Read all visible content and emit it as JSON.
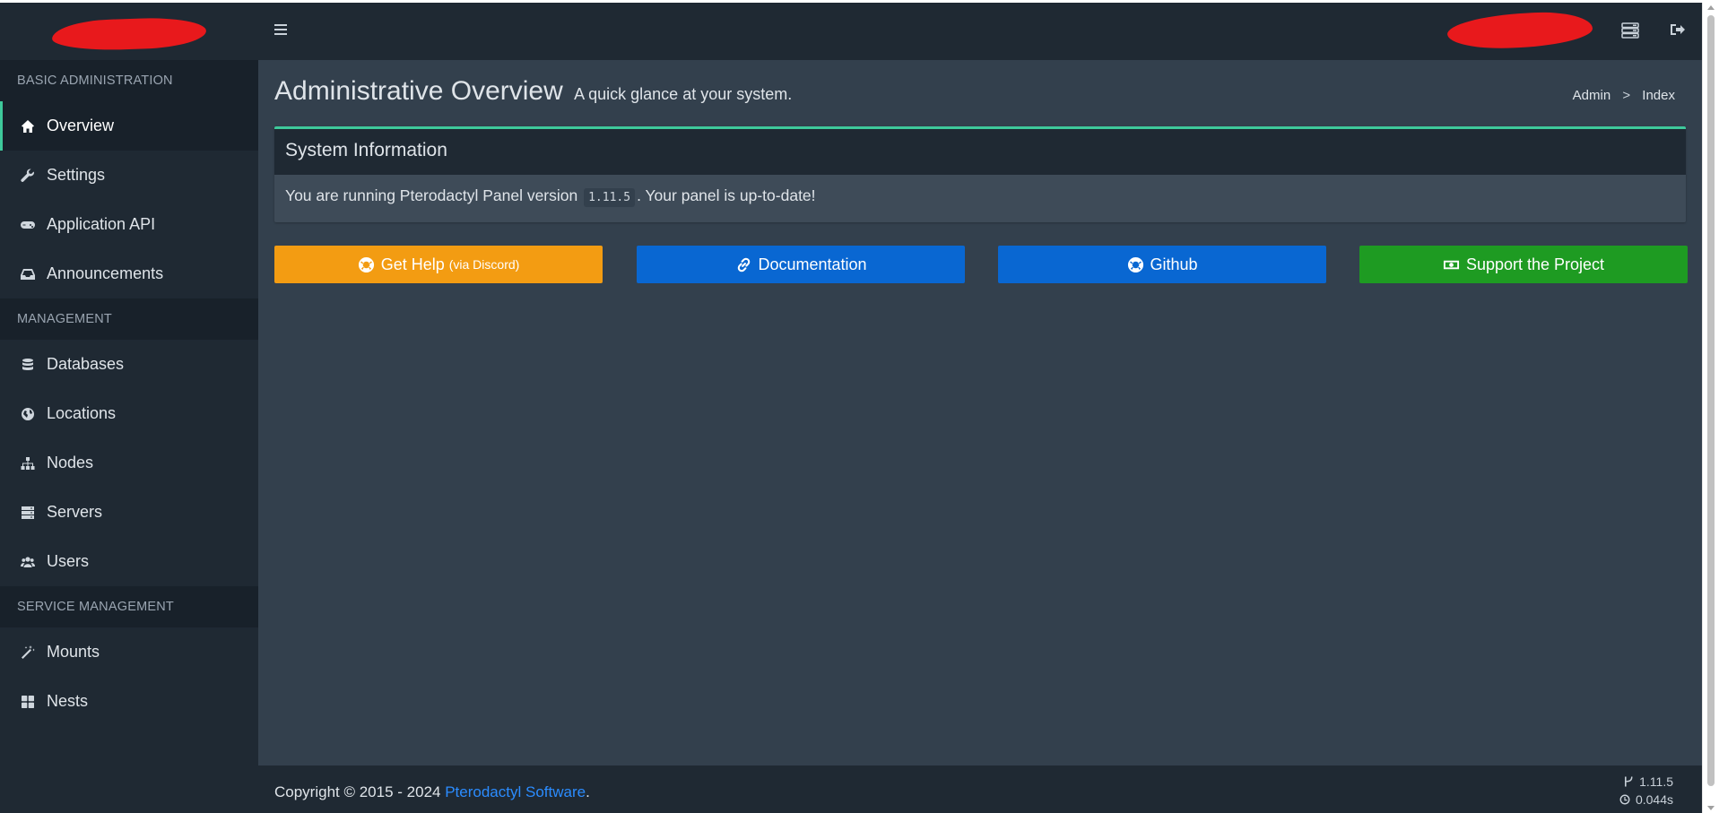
{
  "sidebar": {
    "sections": [
      {
        "header": "BASIC ADMINISTRATION",
        "items": [
          {
            "label": "Overview",
            "icon": "home-icon",
            "active": true
          },
          {
            "label": "Settings",
            "icon": "wrench-icon"
          },
          {
            "label": "Application API",
            "icon": "gamepad-icon"
          },
          {
            "label": "Announcements",
            "icon": "inbox-icon"
          }
        ]
      },
      {
        "header": "MANAGEMENT",
        "items": [
          {
            "label": "Databases",
            "icon": "database-icon"
          },
          {
            "label": "Locations",
            "icon": "globe-icon"
          },
          {
            "label": "Nodes",
            "icon": "sitemap-icon"
          },
          {
            "label": "Servers",
            "icon": "server-icon"
          },
          {
            "label": "Users",
            "icon": "users-icon"
          }
        ]
      },
      {
        "header": "SERVICE MANAGEMENT",
        "items": [
          {
            "label": "Mounts",
            "icon": "magic-wand-icon"
          },
          {
            "label": "Nests",
            "icon": "th-large-icon"
          }
        ]
      }
    ]
  },
  "header": {
    "title": "Administrative Overview",
    "subtitle": "A quick glance at your system."
  },
  "breadcrumb": {
    "items": [
      "Admin",
      "Index"
    ],
    "separator": ">"
  },
  "system_info": {
    "title": "System Information",
    "text_before": "You are running Pterodactyl Panel version",
    "version": "1.11.5",
    "text_after": ". Your panel is up-to-date!"
  },
  "buttons": {
    "help": {
      "label": "Get Help",
      "suffix": "(via Discord)",
      "icon": "life-ring-icon",
      "color": "#f39c12"
    },
    "docs": {
      "label": "Documentation",
      "icon": "link-icon",
      "color": "#0967d2"
    },
    "github": {
      "label": "Github",
      "icon": "life-ring-icon",
      "color": "#0967d2"
    },
    "support": {
      "label": "Support the Project",
      "icon": "money-icon",
      "color": "#1e9b22"
    }
  },
  "footer": {
    "copyright_prefix": "Copyright © 2015 - 2024",
    "company_link": "Pterodactyl Software",
    "copyright_suffix": ".",
    "version": "1.11.5",
    "time": "0.044s"
  },
  "colors": {
    "accent": "#3ec99b",
    "header_bg": "#1f2933",
    "content_bg": "#33404d",
    "link": "#2b8cff"
  }
}
